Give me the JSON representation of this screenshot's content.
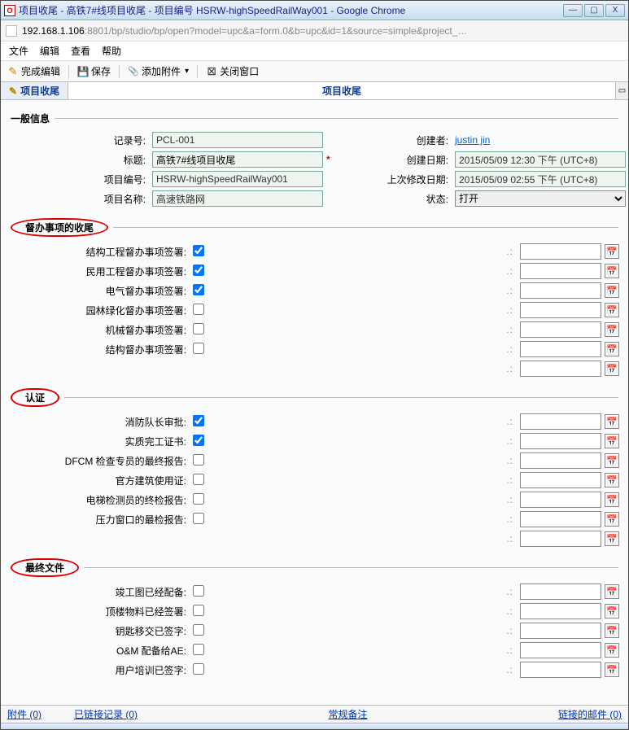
{
  "window": {
    "title": "项目收尾 - 高铁7#线项目收尾 - 项目编号 HSRW-highSpeedRailWay001 - Google Chrome",
    "min": "—",
    "max": "▢",
    "close": "X"
  },
  "url": {
    "host": "192.168.1.106",
    "rest": ":8801/bp/studio/bp/open?model=upc&a=form.0&b=upc&id=1&source=simple&project_…"
  },
  "menubar": {
    "file": "文件",
    "edit": "编辑",
    "view": "查看",
    "help": "帮助"
  },
  "toolbar": {
    "finish_edit": "完成编辑",
    "save": "保存",
    "add_attach": "添加附件",
    "close_window": "关闭窗口"
  },
  "tabs": {
    "active": "项目收尾",
    "center_title": "项目收尾",
    "collapse": "▭"
  },
  "sections": {
    "general": "一般信息",
    "backlog": "督办事项的收尾",
    "cert": "认证",
    "finaldoc": "最终文件"
  },
  "general": {
    "record_no_lbl": "记录号:",
    "record_no": "PCL-001",
    "title_lbl": "标题:",
    "title": "高铁7#线项目收尾",
    "project_no_lbl": "项目编号:",
    "project_no": "HSRW-highSpeedRailWay001",
    "project_name_lbl": "项目名称:",
    "project_name": "高速铁路网",
    "creator_lbl": "创建者:",
    "creator": "justin jin",
    "created_lbl": "创建日期:",
    "created": "2015/05/09 12:30 下午 (UTC+8)",
    "modified_lbl": "上次修改日期:",
    "modified": "2015/05/09 02:55 下午 (UTC+8)",
    "status_lbl": "状态:",
    "status": "打开",
    "asterisk": "*"
  },
  "backlog": {
    "items": [
      {
        "label": "结构工程督办事项签署:",
        "checked": true
      },
      {
        "label": "民用工程督办事项签署:",
        "checked": true
      },
      {
        "label": "电气督办事项签署:",
        "checked": true
      },
      {
        "label": "园林绿化督办事项签署:",
        "checked": false
      },
      {
        "label": "机械督办事项签署:",
        "checked": false
      },
      {
        "label": "结构督办事项签署:",
        "checked": false
      }
    ],
    "dots": ".:"
  },
  "cert": {
    "items": [
      {
        "label": "消防队长审批:",
        "checked": true
      },
      {
        "label": "实质完工证书:",
        "checked": true
      },
      {
        "label": "DFCM 检查专员的最终报告:",
        "checked": false
      },
      {
        "label": "官方建筑使用证:",
        "checked": false
      },
      {
        "label": "电梯检测员的终检报告:",
        "checked": false
      },
      {
        "label": "压力窗口的最检报告:",
        "checked": false
      }
    ],
    "dots": ".:"
  },
  "finaldoc": {
    "items": [
      {
        "label": "竣工图已经配备:",
        "checked": false
      },
      {
        "label": "顶楼物料已经签署:",
        "checked": false
      },
      {
        "label": "钥匙移交已签字:",
        "checked": false
      },
      {
        "label": "O&M 配备给AE:",
        "checked": false
      },
      {
        "label": "用户培训已签字:",
        "checked": false
      }
    ]
  },
  "footer": {
    "attachments": "附件 (0)",
    "linked_records": "已链接记录 (0)",
    "remarks": "常规备注",
    "linked_mail": "链接的邮件 (0)"
  }
}
